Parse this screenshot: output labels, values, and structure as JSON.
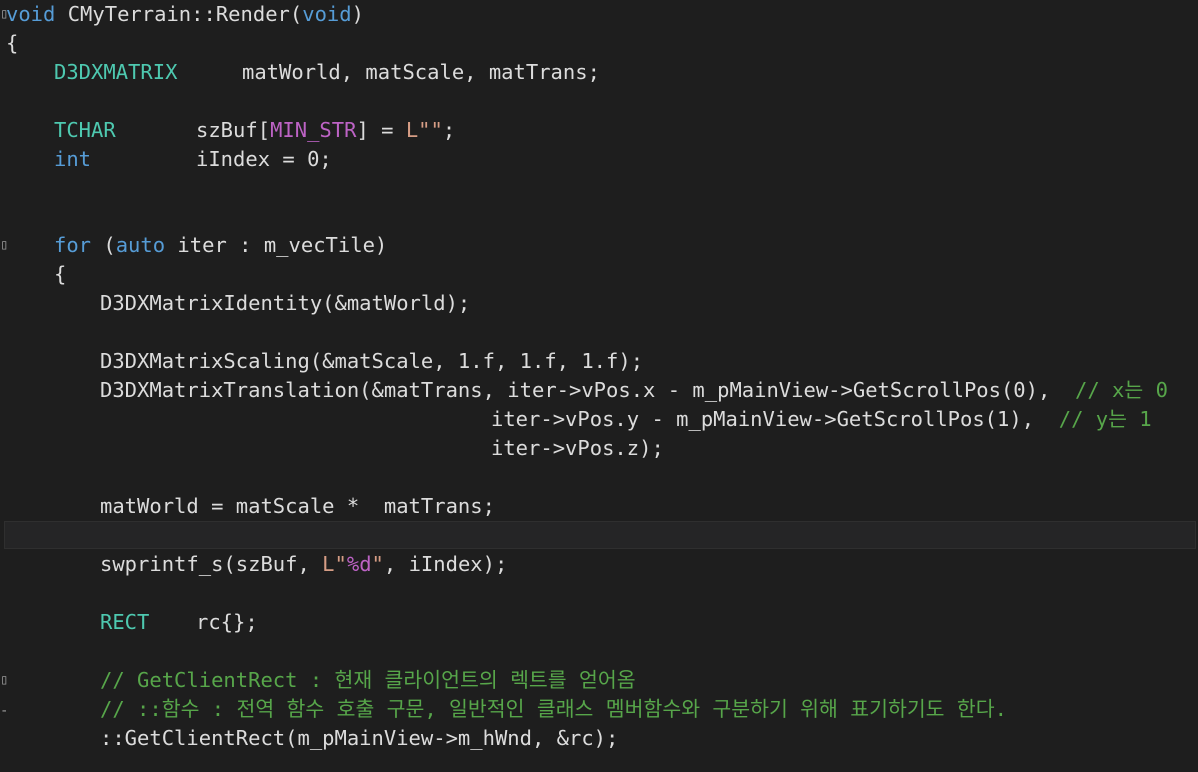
{
  "code": {
    "l1": {
      "kw_void": "void",
      "cls": "CMyTerrain",
      "sep": "::",
      "fn": "Render",
      "open": "(",
      "kw_void2": "void",
      "close": ")"
    },
    "l2": {
      "brace": "{"
    },
    "l3": {
      "type": "D3DXMATRIX",
      "rest": "matWorld, matScale, matTrans;"
    },
    "l5": {
      "type": "TCHAR",
      "var": "szBuf[",
      "macro": "MIN_STR",
      "mid": "] = ",
      "str": "L\"\"",
      "end": ";"
    },
    "l6": {
      "kw": "int",
      "rest": "iIndex = 0;"
    },
    "l9": {
      "kw_for": "for",
      "p1": " (",
      "kw_auto": "auto",
      "rest": " iter : m_vecTile)"
    },
    "l10": {
      "brace": "{"
    },
    "l11": {
      "text": "D3DXMatrixIdentity(&matWorld);"
    },
    "l13": {
      "text": "D3DXMatrixScaling(&matScale, 1.f, 1.f, 1.f);"
    },
    "l14": {
      "text": "D3DXMatrixTranslation(&matTrans, iter->vPos.x - m_pMainView->GetScrollPos(0),  ",
      "comment": "// x는 0"
    },
    "l15": {
      "text": "iter->vPos.y - m_pMainView->GetScrollPos(1),  ",
      "comment": "// y는 1"
    },
    "l16": {
      "text": "iter->vPos.z);"
    },
    "l18": {
      "text": "matWorld = matScale *  matTrans;"
    },
    "l20": {
      "p1": "swprintf_s(szBuf, ",
      "str1": "L\"",
      "fmt": "%d",
      "str2": "\"",
      "p2": ", iIndex);"
    },
    "l22": {
      "type": "RECT",
      "rest": "rc{};"
    },
    "l24": {
      "comment": "// GetClientRect : 현재 클라이언트의 렉트를 얻어옴"
    },
    "l25": {
      "comment": "// ::함수 : 전역 함수 호출 구문, 일반적인 클래스 멤버함수와 구분하기 위해 표기하기도 한다."
    },
    "l26": {
      "text": "::GetClientRect(m_pMainView->m_hWnd, &rc);"
    }
  }
}
